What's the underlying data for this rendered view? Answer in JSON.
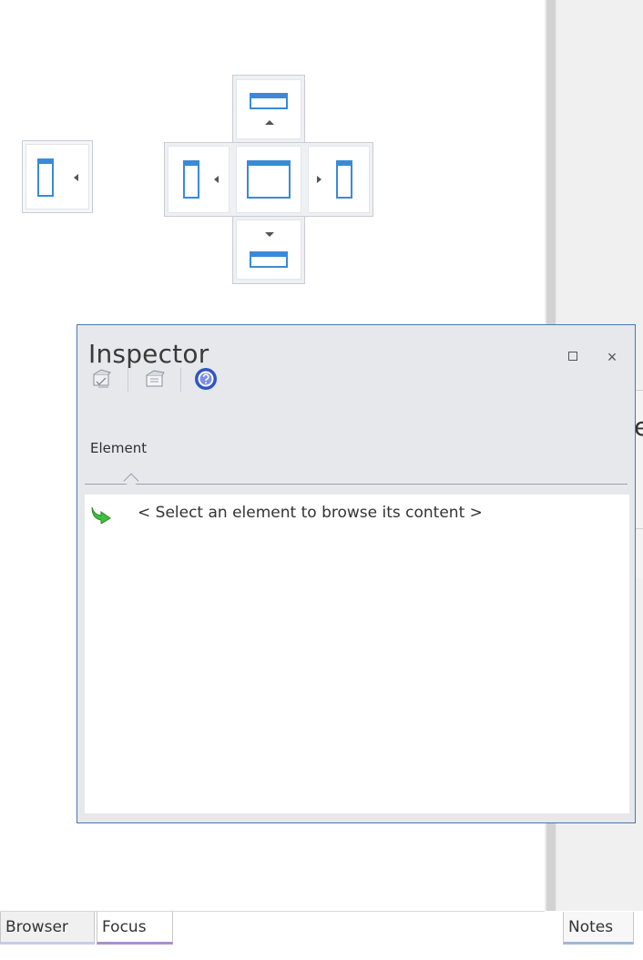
{
  "inspector": {
    "title": "Inspector",
    "tab_element": "Element",
    "hint": "< Select an element to browse its content >",
    "icons": {
      "tool1": "element-details-icon",
      "tool2": "element-features-icon",
      "help": "help-icon",
      "maximize": "maximize-icon",
      "close": "close-icon",
      "hint": "green-arrow-icon"
    },
    "close_glyph": "×"
  },
  "right_pane": {
    "peek_letter": "e"
  },
  "bottom_tabs": {
    "browser": "Browser",
    "focus": "Focus",
    "notes": "Notes"
  },
  "colors": {
    "accent_blue": "#3a8ad8",
    "window_border": "#4a78a8",
    "focus_tab_underline": "#a88fd0"
  }
}
